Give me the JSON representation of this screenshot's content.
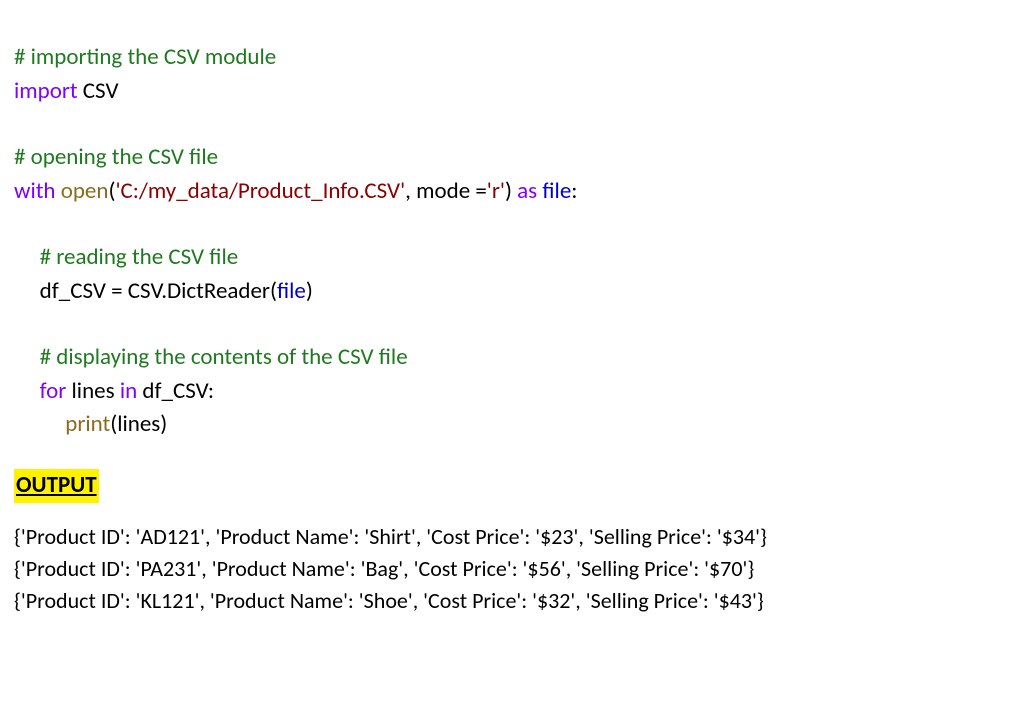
{
  "code": {
    "comment_import": "# importing the CSV module",
    "kw_import": "import",
    "sp": " ",
    "csv_mod": "CSV",
    "comment_open": "# opening the CSV file",
    "kw_with": "with",
    "fn_open": "open",
    "lparen": "(",
    "str_path": "'C:/my_data/Product_Info.CSV'",
    "comma_sp": ", ",
    "mode_text": "mode =",
    "str_mode": "'r'",
    "rparen": ")",
    "kw_as": "as",
    "var_file": "file",
    "colon": ":",
    "comment_read": "# reading the CSV file",
    "assign_df": "df_CSV = CSV.DictReader(",
    "close_paren": ")",
    "comment_disp": "# displaying the contents of the CSV file",
    "kw_for": "for",
    "lines_in_df": " lines ",
    "kw_in": "in",
    "df_csv_colon": " df_CSV:",
    "fn_print": "print",
    "print_arg": "(lines)"
  },
  "output": {
    "header": "OUTPUT",
    "rows": [
      {
        "Product ID": "AD121",
        "Product Name": "Shirt",
        "Cost Price": "$23",
        "Selling Price": "$34"
      },
      {
        "Product ID": "PA231",
        "Product Name": "Bag",
        "Cost Price": "$56",
        "Selling Price": "$70"
      },
      {
        "Product ID": "KL121",
        "Product Name": "Shoe",
        "Cost Price": "$32",
        "Selling Price": "$43"
      }
    ]
  }
}
